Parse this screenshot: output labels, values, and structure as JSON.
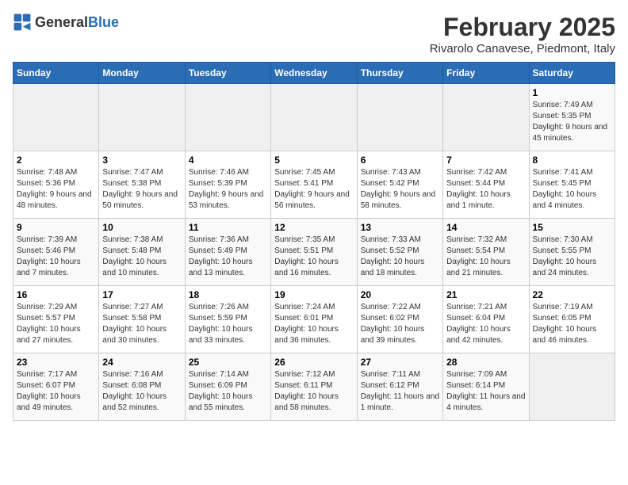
{
  "header": {
    "logo_general": "General",
    "logo_blue": "Blue",
    "month_title": "February 2025",
    "subtitle": "Rivarolo Canavese, Piedmont, Italy"
  },
  "days_of_week": [
    "Sunday",
    "Monday",
    "Tuesday",
    "Wednesday",
    "Thursday",
    "Friday",
    "Saturday"
  ],
  "weeks": [
    [
      {
        "num": "",
        "info": ""
      },
      {
        "num": "",
        "info": ""
      },
      {
        "num": "",
        "info": ""
      },
      {
        "num": "",
        "info": ""
      },
      {
        "num": "",
        "info": ""
      },
      {
        "num": "",
        "info": ""
      },
      {
        "num": "1",
        "info": "Sunrise: 7:49 AM\nSunset: 5:35 PM\nDaylight: 9 hours and 45 minutes."
      }
    ],
    [
      {
        "num": "2",
        "info": "Sunrise: 7:48 AM\nSunset: 5:36 PM\nDaylight: 9 hours and 48 minutes."
      },
      {
        "num": "3",
        "info": "Sunrise: 7:47 AM\nSunset: 5:38 PM\nDaylight: 9 hours and 50 minutes."
      },
      {
        "num": "4",
        "info": "Sunrise: 7:46 AM\nSunset: 5:39 PM\nDaylight: 9 hours and 53 minutes."
      },
      {
        "num": "5",
        "info": "Sunrise: 7:45 AM\nSunset: 5:41 PM\nDaylight: 9 hours and 56 minutes."
      },
      {
        "num": "6",
        "info": "Sunrise: 7:43 AM\nSunset: 5:42 PM\nDaylight: 9 hours and 58 minutes."
      },
      {
        "num": "7",
        "info": "Sunrise: 7:42 AM\nSunset: 5:44 PM\nDaylight: 10 hours and 1 minute."
      },
      {
        "num": "8",
        "info": "Sunrise: 7:41 AM\nSunset: 5:45 PM\nDaylight: 10 hours and 4 minutes."
      }
    ],
    [
      {
        "num": "9",
        "info": "Sunrise: 7:39 AM\nSunset: 5:46 PM\nDaylight: 10 hours and 7 minutes."
      },
      {
        "num": "10",
        "info": "Sunrise: 7:38 AM\nSunset: 5:48 PM\nDaylight: 10 hours and 10 minutes."
      },
      {
        "num": "11",
        "info": "Sunrise: 7:36 AM\nSunset: 5:49 PM\nDaylight: 10 hours and 13 minutes."
      },
      {
        "num": "12",
        "info": "Sunrise: 7:35 AM\nSunset: 5:51 PM\nDaylight: 10 hours and 16 minutes."
      },
      {
        "num": "13",
        "info": "Sunrise: 7:33 AM\nSunset: 5:52 PM\nDaylight: 10 hours and 18 minutes."
      },
      {
        "num": "14",
        "info": "Sunrise: 7:32 AM\nSunset: 5:54 PM\nDaylight: 10 hours and 21 minutes."
      },
      {
        "num": "15",
        "info": "Sunrise: 7:30 AM\nSunset: 5:55 PM\nDaylight: 10 hours and 24 minutes."
      }
    ],
    [
      {
        "num": "16",
        "info": "Sunrise: 7:29 AM\nSunset: 5:57 PM\nDaylight: 10 hours and 27 minutes."
      },
      {
        "num": "17",
        "info": "Sunrise: 7:27 AM\nSunset: 5:58 PM\nDaylight: 10 hours and 30 minutes."
      },
      {
        "num": "18",
        "info": "Sunrise: 7:26 AM\nSunset: 5:59 PM\nDaylight: 10 hours and 33 minutes."
      },
      {
        "num": "19",
        "info": "Sunrise: 7:24 AM\nSunset: 6:01 PM\nDaylight: 10 hours and 36 minutes."
      },
      {
        "num": "20",
        "info": "Sunrise: 7:22 AM\nSunset: 6:02 PM\nDaylight: 10 hours and 39 minutes."
      },
      {
        "num": "21",
        "info": "Sunrise: 7:21 AM\nSunset: 6:04 PM\nDaylight: 10 hours and 42 minutes."
      },
      {
        "num": "22",
        "info": "Sunrise: 7:19 AM\nSunset: 6:05 PM\nDaylight: 10 hours and 46 minutes."
      }
    ],
    [
      {
        "num": "23",
        "info": "Sunrise: 7:17 AM\nSunset: 6:07 PM\nDaylight: 10 hours and 49 minutes."
      },
      {
        "num": "24",
        "info": "Sunrise: 7:16 AM\nSunset: 6:08 PM\nDaylight: 10 hours and 52 minutes."
      },
      {
        "num": "25",
        "info": "Sunrise: 7:14 AM\nSunset: 6:09 PM\nDaylight: 10 hours and 55 minutes."
      },
      {
        "num": "26",
        "info": "Sunrise: 7:12 AM\nSunset: 6:11 PM\nDaylight: 10 hours and 58 minutes."
      },
      {
        "num": "27",
        "info": "Sunrise: 7:11 AM\nSunset: 6:12 PM\nDaylight: 11 hours and 1 minute."
      },
      {
        "num": "28",
        "info": "Sunrise: 7:09 AM\nSunset: 6:14 PM\nDaylight: 11 hours and 4 minutes."
      },
      {
        "num": "",
        "info": ""
      }
    ]
  ]
}
